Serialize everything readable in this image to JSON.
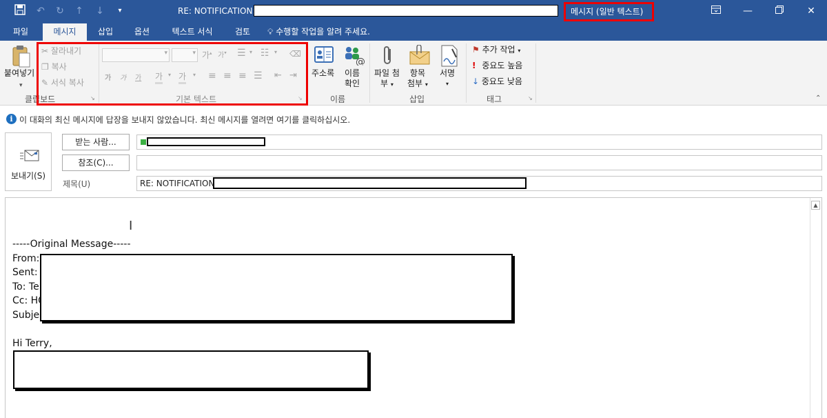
{
  "titlebar": {
    "title": "RE: NOTIFICATION: ",
    "mode": "메시지 (일반 텍스트)",
    "quick_access": [
      "save-icon",
      "undo-icon",
      "redo-icon",
      "up-icon",
      "down-icon",
      "customize-icon"
    ]
  },
  "tabs": [
    "파일",
    "메시지",
    "삽입",
    "옵션",
    "텍스트 서식",
    "검토",
    "수행할 작업을 알려 주세요."
  ],
  "ribbon": {
    "clipboard": {
      "paste_label": "붙여넣기",
      "cut": "잘라내기",
      "copy": "복사",
      "format_painter": "서식 복사",
      "group": "클립보드"
    },
    "basic_text": {
      "bold": "가",
      "italic": "가",
      "underline": "가",
      "highlight": "가",
      "font_color": "가",
      "group": "기본 텍스트"
    },
    "names": {
      "address_book": "주소록",
      "check_names_1": "이름",
      "check_names_2": "확인",
      "group": "이름"
    },
    "include": {
      "attach_file_1": "파일 첨",
      "attach_file_2": "부",
      "attach_item_1": "항목",
      "attach_item_2": "첨부",
      "signature": "서명",
      "group": "삽입"
    },
    "tags": {
      "follow_up": "추가 작업",
      "high_importance": "중요도 높음",
      "low_importance": "중요도 낮음",
      "group": "태그"
    }
  },
  "infobar": {
    "text": "이 대화의 최신 메시지에 답장을 보내지 않았습니다. 최신 메시지를 열려면 여기를 클릭하십시오."
  },
  "header": {
    "send_label": "보내기(S)",
    "to_button": "받는 사람...",
    "cc_button": "참조(C)...",
    "subject_label": "제목(U)",
    "subject_value": "RE: NOTIFICATION: "
  },
  "body": {
    "lines": [
      "-----Original Message-----",
      "From: ",
      "Sent: T",
      "To: Te",
      "Cc: HC",
      "Subjec",
      "",
      "Hi Terry,"
    ]
  },
  "colors": {
    "titlebar": "#2b579a",
    "ribbon": "#f3f3f3",
    "highlight_border": "#e00000"
  }
}
